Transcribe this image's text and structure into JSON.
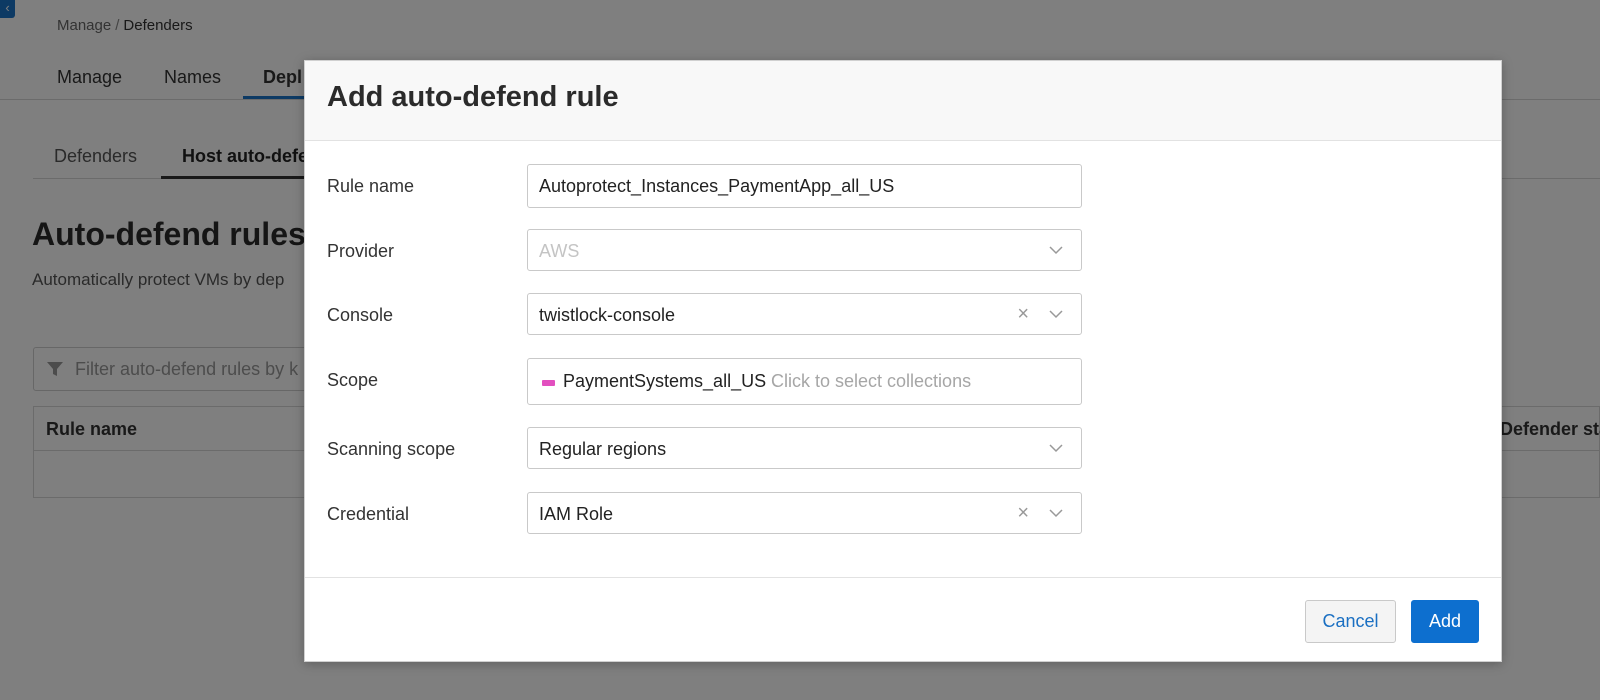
{
  "page": {
    "back_icon": "chevron-left-icon",
    "breadcrumb": {
      "parent": "Manage",
      "separator": "/",
      "current": "Defenders"
    },
    "top_tabs": [
      {
        "label": "Manage"
      },
      {
        "label": "Names"
      },
      {
        "label": "Depl"
      }
    ],
    "sub_tabs": [
      {
        "label": "Defenders"
      },
      {
        "label": "Host auto-defe"
      }
    ],
    "section_title": "Auto-defend rules",
    "section_description": "Automatically protect VMs by dep",
    "filter": {
      "placeholder": "Filter auto-defend rules by k",
      "icon": "filter-icon"
    },
    "table": {
      "columns": [
        "Rule name",
        "Defender sta"
      ]
    }
  },
  "modal": {
    "title": "Add auto-defend rule",
    "fields": {
      "rule_name": {
        "label": "Rule name",
        "value": "Autoprotect_Instances_PaymentApp_all_US"
      },
      "provider": {
        "label": "Provider",
        "value": "AWS",
        "disabled": true
      },
      "console": {
        "label": "Console",
        "value": "twistlock-console"
      },
      "scope": {
        "label": "Scope",
        "tag": "PaymentSystems_all_US",
        "tag_color": "#e24fbf",
        "placeholder": "Click to select collections"
      },
      "scanning_scope": {
        "label": "Scanning scope",
        "value": "Regular regions"
      },
      "credential": {
        "label": "Credential",
        "value": "IAM Role"
      }
    },
    "buttons": {
      "cancel": "Cancel",
      "add": "Add"
    }
  },
  "colors": {
    "primary": "#0d6fcf",
    "link": "#1a6fc2",
    "overlay": "rgba(0,0,0,0.5)"
  }
}
